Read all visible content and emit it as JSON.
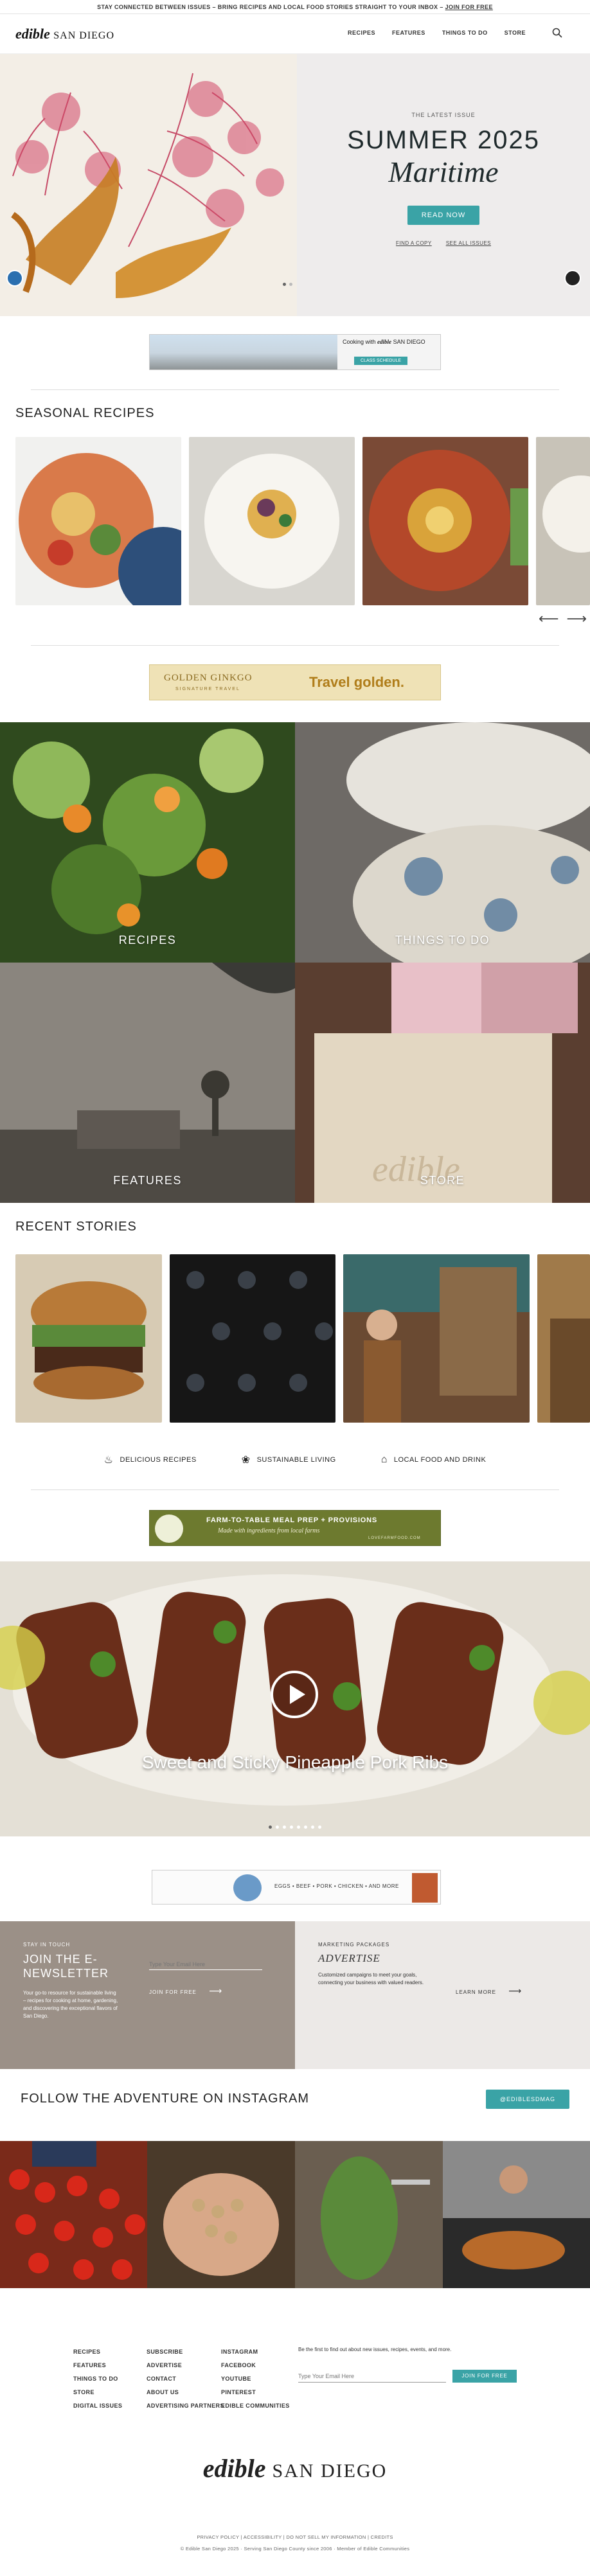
{
  "topbar": {
    "text": "STAY CONNECTED BETWEEN ISSUES – BRING RECIPES AND LOCAL FOOD STORIES STRAIGHT TO YOUR INBOX –",
    "link": "JOIN FOR FREE"
  },
  "header": {
    "logo_script": "edible",
    "logo_city": "SAN DIEGO",
    "nav": [
      "RECIPES",
      "FEATURES",
      "THINGS TO DO",
      "STORE"
    ]
  },
  "hero": {
    "kicker": "THE LATEST ISSUE",
    "title": "SUMMER 2025",
    "subtitle": "Maritime",
    "button": "READ NOW",
    "links": [
      "FIND A COPY",
      "SEE ALL ISSUES"
    ]
  },
  "ad1": {
    "lead": "Cooking with",
    "brand": "edible",
    "line": "SAN DIEGO",
    "cta": "CLASS SCHEDULE"
  },
  "seasonal": {
    "title": "SEASONAL RECIPES"
  },
  "ad2": {
    "brand": "GOLDEN GINKGO",
    "sub": "SIGNATURE TRAVEL",
    "tagline": "Travel golden."
  },
  "tiles": [
    "RECIPES",
    "THINGS TO DO",
    "FEATURES",
    "STORE"
  ],
  "recent": {
    "title": "RECENT STORIES"
  },
  "categories": [
    "DELICIOUS RECIPES",
    "SUSTAINABLE LIVING",
    "LOCAL FOOD AND DRINK"
  ],
  "ad3": {
    "title": "FARM-TO-TABLE MEAL PREP + PROVISIONS",
    "sub": "Made with ingredients from local farms",
    "url": "LOVEFARMFOOD.COM"
  },
  "video": {
    "caption": "Sweet and Sticky Pineapple Pork Ribs"
  },
  "ad4": {
    "text": "EGGS • BEEF • PORK • CHICKEN • AND MORE"
  },
  "newsletter": {
    "kicker": "STAY IN TOUCH",
    "title": "JOIN THE E-NEWSLETTER",
    "body": "Your go-to resource for sustainable living – recipes for cooking at home, gardening, and discovering the exceptional flavors of San Diego.",
    "placeholder": "Type Your Email Here",
    "button": "JOIN FOR FREE"
  },
  "marketing": {
    "kicker": "MARKETING PACKAGES",
    "title": "ADVERTISE",
    "body": "Customized campaigns to meet your goals, connecting your business with valued readers.",
    "button": "LEARN MORE"
  },
  "instagram": {
    "title": "FOLLOW THE ADVENTURE ON INSTAGRAM",
    "handle": "@EDIBLESDMAG"
  },
  "footer": {
    "col1": [
      "RECIPES",
      "FEATURES",
      "THINGS TO DO",
      "STORE",
      "DIGITAL ISSUES"
    ],
    "col2": [
      "SUBSCRIBE",
      "ADVERTISE",
      "CONTACT",
      "ABOUT US",
      "ADVERTISING PARTNERS"
    ],
    "col3": [
      "INSTAGRAM",
      "FACEBOOK",
      "YOUTUBE",
      "PINTEREST",
      "EDIBLE COMMUNITIES"
    ],
    "news_text": "Be the first to find out about new issues, recipes, events, and more.",
    "placeholder": "Type Your Email Here",
    "button": "JOIN FOR FREE",
    "logo_script": "edible",
    "logo_city": "SAN DIEGO",
    "legal_links": "PRIVACY POLICY | ACCESSIBILITY | DO NOT SELL MY INFORMATION | CREDITS",
    "copyright": "© Edible San Diego 2025 · Serving San Diego County since 2006 · Member of Edible Communities"
  }
}
